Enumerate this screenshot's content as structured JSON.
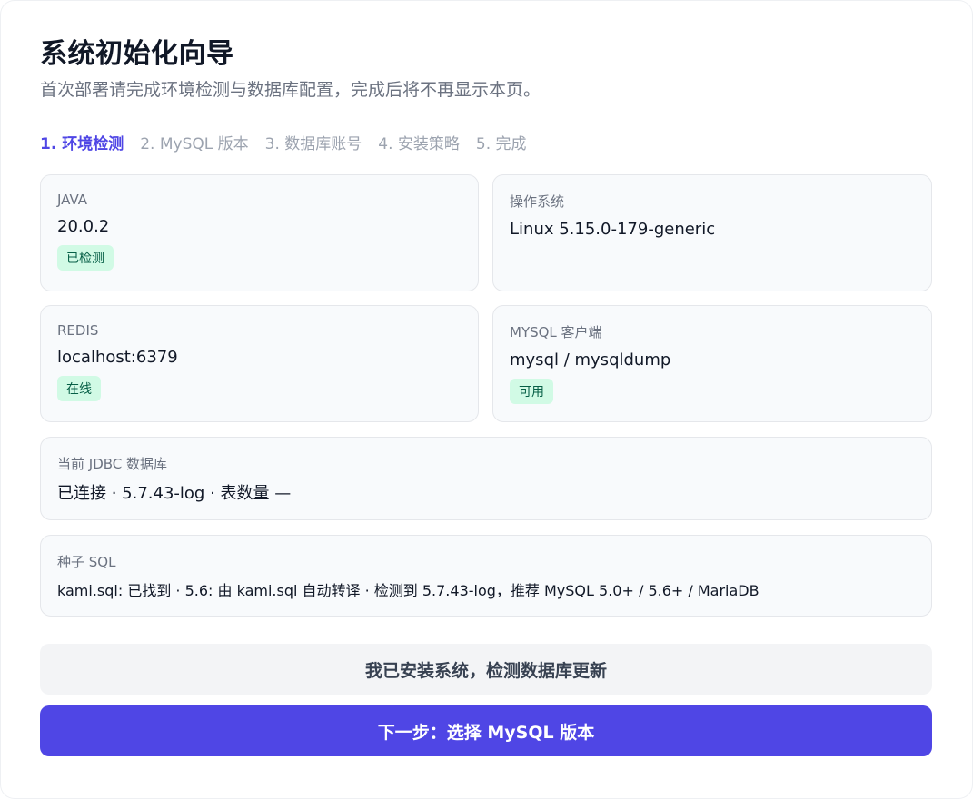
{
  "header": {
    "title": "系统初始化向导",
    "subtitle": "首次部署请完成环境检测与数据库配置，完成后将不再显示本页。"
  },
  "steps": [
    {
      "label": "1. 环境检测",
      "active": true
    },
    {
      "label": "2. MySQL 版本",
      "active": false
    },
    {
      "label": "3. 数据库账号",
      "active": false
    },
    {
      "label": "4. 安装策略",
      "active": false
    },
    {
      "label": "5. 完成",
      "active": false
    }
  ],
  "env": {
    "java": {
      "label": "JAVA",
      "value": "20.0.2",
      "badge": "已检测"
    },
    "os": {
      "label": "操作系统",
      "value": "Linux 5.15.0-179-generic"
    },
    "redis": {
      "label": "REDIS",
      "value": "localhost:6379",
      "badge": "在线"
    },
    "mysql_client": {
      "label": "MYSQL 客户端",
      "value": "mysql / mysqldump",
      "badge": "可用"
    },
    "jdbc": {
      "label": "当前 JDBC 数据库",
      "value": "已连接 · 5.7.43-log · 表数量 —"
    },
    "seed": {
      "label": "种子 SQL",
      "value": "kami.sql: 已找到 · 5.6: 由 kami.sql 自动转译 · 检测到 5.7.43-log，推荐 MySQL 5.0+ / 5.6+ / MariaDB"
    }
  },
  "actions": {
    "detect_update_label": "我已安装系统，检测数据库更新",
    "next_label": "下一步：选择 MySQL 版本"
  },
  "colors": {
    "accent": "#4f46e5",
    "badge_bg": "#d1fae5",
    "badge_text": "#065f46"
  }
}
